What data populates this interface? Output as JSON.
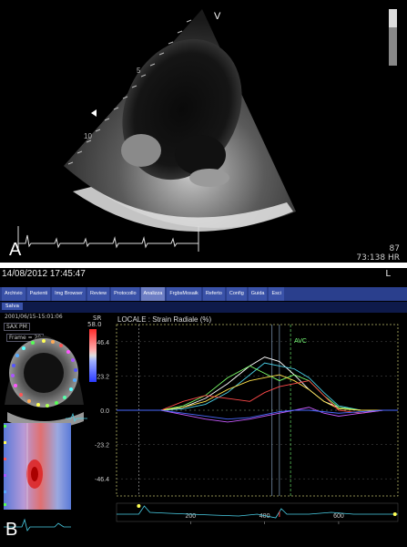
{
  "panel_a": {
    "label": "A",
    "probe_marker": "V",
    "depth_marks": [
      "5",
      "10"
    ],
    "hr_value": "87",
    "hr_unit": "HR",
    "frame_info": "73:138"
  },
  "panel_b": {
    "label": "B",
    "timestamp": "14/08/2012 17:45:47",
    "corner_mark": "L",
    "menu": {
      "items": [
        "Archivio",
        "Pazienti",
        "Img Browser",
        "Review",
        "Protocollo",
        "Analizza",
        "FrgbsMosaik",
        "Referto",
        "Config",
        "Guida",
        "Esci"
      ],
      "active_index": 5
    },
    "save_button": "Salva",
    "acq_date": "2001/06/15-15:01:06",
    "view_label": "SAX PM",
    "frame_label": "Frame = 29",
    "sr_label": "SR",
    "sr_value": "58.0"
  },
  "chart_data": {
    "type": "line",
    "title": "LOCALE : Strain Radiale (%)",
    "xlabel": "",
    "ylabel": "",
    "ylim": [
      -58,
      58
    ],
    "xlim": [
      0,
      760
    ],
    "y_ticks": [
      "46.4",
      "23.2",
      "0.0",
      "-23.2",
      "-46.4"
    ],
    "x_ticks": [
      "200",
      "400",
      "600"
    ],
    "annotation": "AVC",
    "x": [
      0,
      60,
      120,
      180,
      240,
      300,
      360,
      400,
      440,
      480,
      520,
      560,
      600,
      660,
      720,
      760
    ],
    "series": [
      {
        "color": "#ffffff",
        "values": [
          0,
          0,
          0,
          2,
          8,
          18,
          30,
          36,
          33,
          24,
          14,
          6,
          2,
          0,
          0,
          0
        ]
      },
      {
        "color": "#4ad0e8",
        "values": [
          0,
          0,
          0,
          1,
          4,
          12,
          24,
          32,
          30,
          28,
          22,
          12,
          3,
          0,
          0,
          0
        ]
      },
      {
        "color": "#7cff6a",
        "values": [
          0,
          0,
          0,
          3,
          10,
          22,
          30,
          25,
          20,
          24,
          20,
          10,
          2,
          0,
          0,
          0
        ]
      },
      {
        "color": "#ffe14a",
        "values": [
          0,
          0,
          0,
          2,
          6,
          14,
          20,
          22,
          24,
          20,
          14,
          6,
          1,
          0,
          0,
          0
        ]
      },
      {
        "color": "#ff4a4a",
        "values": [
          0,
          0,
          0,
          6,
          10,
          8,
          6,
          12,
          16,
          18,
          20,
          10,
          0,
          -2,
          0,
          0
        ]
      },
      {
        "color": "#c85aff",
        "values": [
          0,
          0,
          0,
          -3,
          -6,
          -8,
          -6,
          -4,
          -2,
          0,
          2,
          -2,
          -4,
          -2,
          0,
          0
        ]
      },
      {
        "color": "#4a6aff",
        "values": [
          0,
          0,
          0,
          -2,
          -4,
          -6,
          -5,
          -3,
          -1,
          0,
          0,
          -1,
          -2,
          -1,
          0,
          0
        ]
      }
    ],
    "ecg_color": "#4ad0e8"
  }
}
